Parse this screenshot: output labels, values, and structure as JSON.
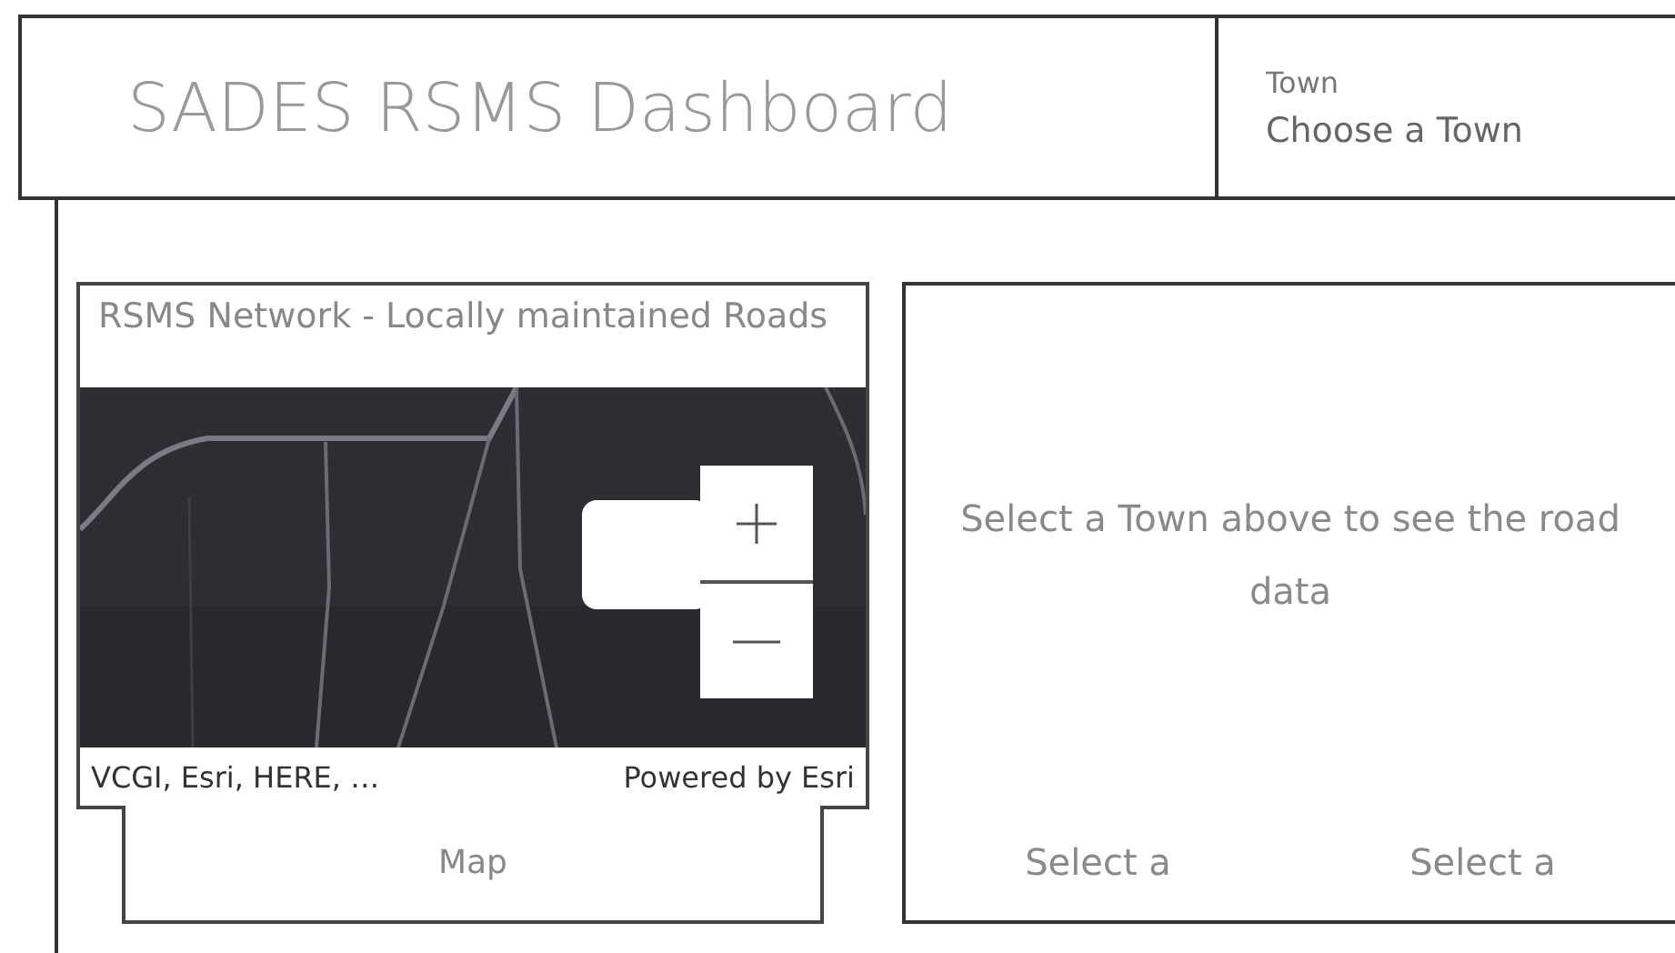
{
  "header": {
    "title": "SADES RSMS Dashboard",
    "town_selector": {
      "label": "Town",
      "placeholder": "Choose a Town"
    }
  },
  "map_card": {
    "title": "RSMS Network  - Locally maintained Roads",
    "attribution": "VCGI, Esri, HERE, …",
    "powered_by": "Powered by Esri",
    "tab": "Map"
  },
  "info_panel": {
    "message": "Select a Town above to see the road data",
    "selectors": [
      "Select a",
      "Select a"
    ]
  }
}
